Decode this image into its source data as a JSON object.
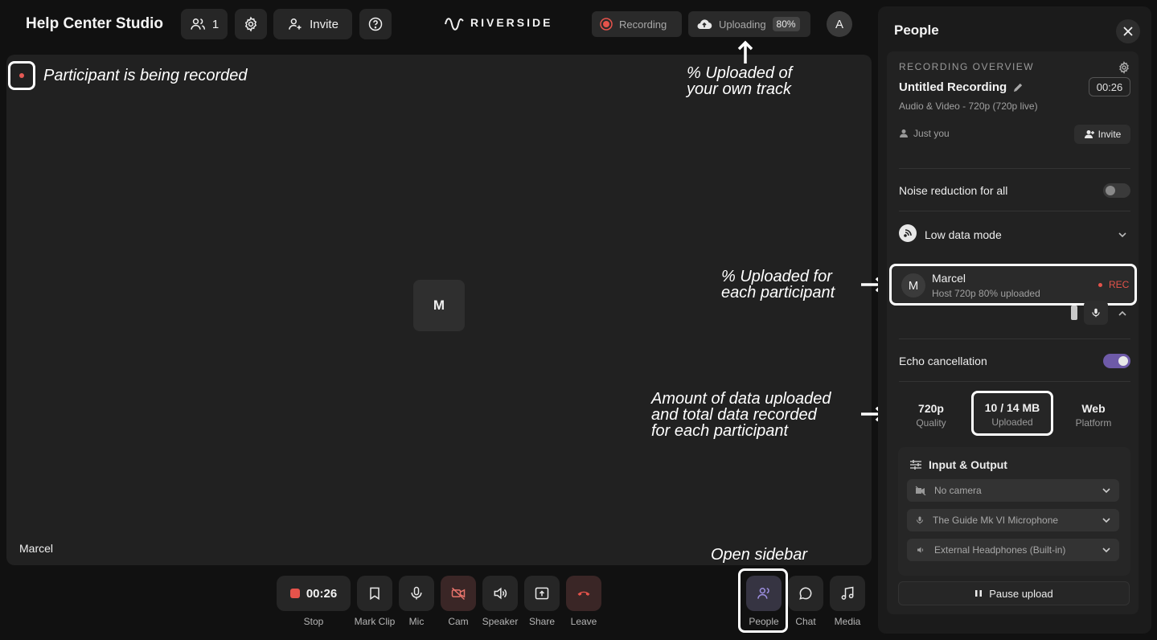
{
  "header": {
    "studio_name": "Help Center Studio",
    "participants_count": "1",
    "invite_label": "Invite",
    "brand": "RIVERSIDE",
    "recording_label": "Recording",
    "uploading_label": "Uploading",
    "uploading_percent": "80%",
    "avatar_initial": "A"
  },
  "stage": {
    "tile_initial": "M",
    "participant_name": "Marcel"
  },
  "annotations": {
    "recorded": "Participant is being recorded",
    "own_upload_line1": "% Uploaded of",
    "own_upload_line2": "your own track",
    "each_upload_line1": "% Uploaded for",
    "each_upload_line2": "each participant",
    "data_line1": "Amount of data uploaded",
    "data_line2": "and total data recorded",
    "data_line3": "for each participant",
    "open_sidebar": "Open sidebar"
  },
  "controls": {
    "timer": "00:26",
    "stop": "Stop",
    "mark_clip": "Mark Clip",
    "mic": "Mic",
    "cam": "Cam",
    "speaker": "Speaker",
    "share": "Share",
    "leave": "Leave",
    "people": "People",
    "chat": "Chat",
    "media": "Media"
  },
  "sidebar": {
    "title": "People",
    "overview_heading": "RECORDING OVERVIEW",
    "recording_title": "Untitled Recording",
    "recording_time": "00:26",
    "recording_sub": "Audio & Video - 720p (720p live)",
    "just_you": "Just you",
    "invite": "Invite",
    "noise_reduction": "Noise reduction for all",
    "low_data": "Low data mode",
    "participant": {
      "initial": "M",
      "name": "Marcel",
      "meta": "Host  720p  80% uploaded",
      "rec": "REC"
    },
    "echo": "Echo cancellation",
    "stats": [
      {
        "value": "720p",
        "label": "Quality"
      },
      {
        "value": "10 / 14 MB",
        "label": "Uploaded"
      },
      {
        "value": "Web",
        "label": "Platform"
      }
    ],
    "io_title": "Input & Output",
    "camera": "No camera",
    "microphone": "The Guide Mk VI Microphone",
    "speaker": "External Headphones (Built-in)",
    "pause_upload": "Pause upload"
  }
}
